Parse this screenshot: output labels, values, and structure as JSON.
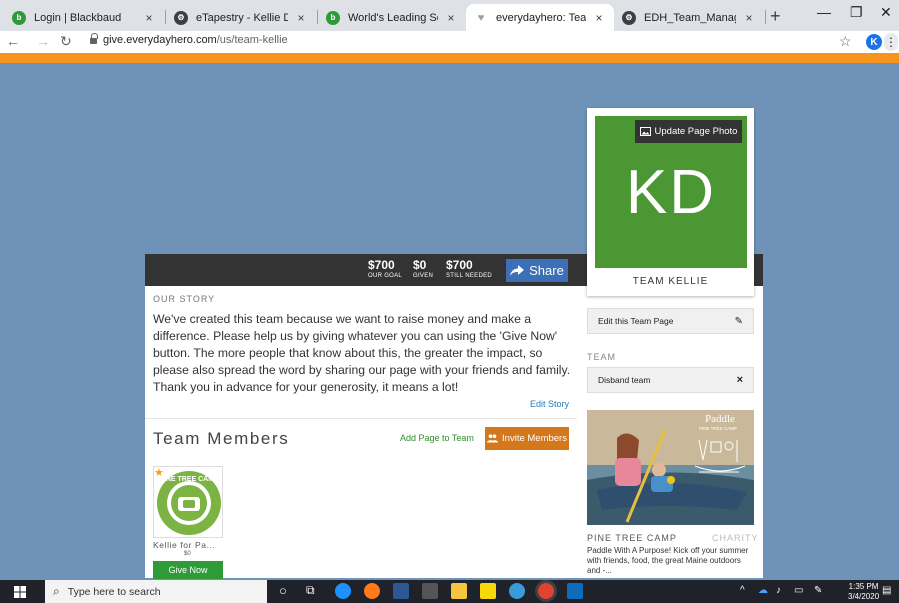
{
  "browser": {
    "tabs": [
      {
        "title": "Login | Blackbaud",
        "fav_color": "#2e9a38",
        "fav_glyph": "b"
      },
      {
        "title": "eTapestry - Kellie DeMers - Pin",
        "fav_color": "#ffffff",
        "fav_glyph": "⚙"
      },
      {
        "title": "World's Leading Software Com",
        "fav_color": "#2e9a38",
        "fav_glyph": "b"
      },
      {
        "title": "everydayhero: Team Kellie",
        "fav_color": "#ffffff",
        "fav_glyph": "♥"
      },
      {
        "title": "EDH_Team_Management_Guid",
        "fav_color": "#ffffff",
        "fav_glyph": "⚙"
      }
    ],
    "close_glyph": "×",
    "new_tab_glyph": "+",
    "url_domain": "give.everydayhero.com",
    "url_path": "/us/team-kellie",
    "profile_initial": "K",
    "icons": [
      "back-icon",
      "forward-icon",
      "reload-icon",
      "lock-icon",
      "star-icon",
      "kebab-icon"
    ]
  },
  "stats": {
    "goal": {
      "value": "$700",
      "label": "OUR GOAL"
    },
    "given": {
      "value": "$0",
      "label": "GIVEN"
    },
    "needed": {
      "value": "$700",
      "label": "STILL NEEDED"
    },
    "share_label": "Share"
  },
  "story": {
    "label": "OUR STORY",
    "text": "We've created this team because we want to raise money and make a difference. Please help us by giving whatever you can using the 'Give Now' button. The more people that know about this, the greater the impact, so please also spread the word by sharing our page with your friends and family. Thank you in advance for your generosity, it means a lot!",
    "edit_label": "Edit Story"
  },
  "members": {
    "title": "Team Members",
    "add_page_label": "Add Page to Team",
    "invite_label": "Invite Members",
    "member": {
      "name": "Kellie for Pa...",
      "amount": "$0",
      "give_label": "Give Now",
      "logo_text": "PINE TREE CAMP"
    }
  },
  "team": {
    "initials": "KD",
    "update_photo_label": "Update Page Photo",
    "name": "TEAM KELLIE",
    "photo_color": "#4a9733",
    "edit_label": "Edit this Team Page",
    "section_label": "TEAM",
    "disband_label": "Disband team"
  },
  "charity": {
    "name": "PINE TREE CAMP",
    "type": "CHARITY",
    "overlay_title": "Paddle",
    "overlay_sub": "PINE TREE CAMP",
    "description": "Paddle With A Purpose! Kick off your summer with friends, food, the great Maine outdoors and -..."
  },
  "taskbar": {
    "search_placeholder": "Type here to search",
    "time": "1:35 PM",
    "date": "3/4/2020"
  },
  "colors": {
    "orange_bar": "#f7941d",
    "background": "#6f93b8",
    "share": "#3c6fb5",
    "invite": "#d4781e",
    "give": "#2e9a38"
  }
}
